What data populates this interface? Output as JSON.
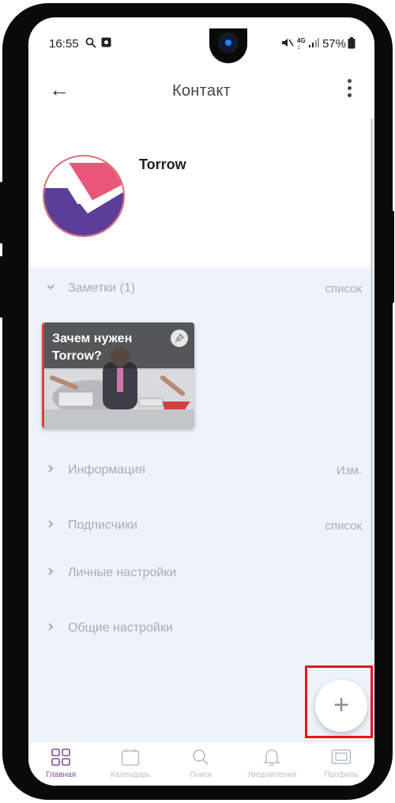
{
  "status_bar": {
    "time": "16:55",
    "right_text": "57%",
    "icons": [
      "search-icon",
      "camera-icon",
      "mute-icon",
      "4g-icon",
      "signal-icon",
      "battery-icon"
    ]
  },
  "app_bar": {
    "title": "Контакт",
    "back_icon": "←",
    "menu_icon": "more-vert-icon"
  },
  "profile": {
    "name": "Torrow",
    "avatar_colors": {
      "top": "#e8577a",
      "bottom": "#5a3e97",
      "ring": "#e06b78"
    }
  },
  "sections": [
    {
      "label": "Заметки (1)",
      "action": "список",
      "expanded": true
    },
    {
      "label": "Информация",
      "action": "Изм.",
      "expanded": false
    },
    {
      "label": "Подписчики",
      "action": "список",
      "expanded": false
    },
    {
      "label": "Личные настройки",
      "action": "",
      "expanded": false
    },
    {
      "label": "Общие настройки",
      "action": "",
      "expanded": false
    }
  ],
  "note": {
    "title": "Зачем нужен Torrow?",
    "pin_icon": "pin-icon"
  },
  "fab": {
    "symbol": "+",
    "highlight_color": "#e8141c"
  },
  "tabs": [
    {
      "label": "Главная",
      "icon": "grid-icon",
      "active": true
    },
    {
      "label": "Календарь",
      "icon": "calendar-icon",
      "active": false
    },
    {
      "label": "Поиск",
      "icon": "search-icon",
      "active": false
    },
    {
      "label": "Уведомления",
      "icon": "bell-icon",
      "active": false
    },
    {
      "label": "Профиль",
      "icon": "profile-card-icon",
      "active": false
    }
  ],
  "colors": {
    "accent": "#7b4fa0",
    "section_bg": "#eef3fb",
    "muted_text": "#a6acb6"
  }
}
